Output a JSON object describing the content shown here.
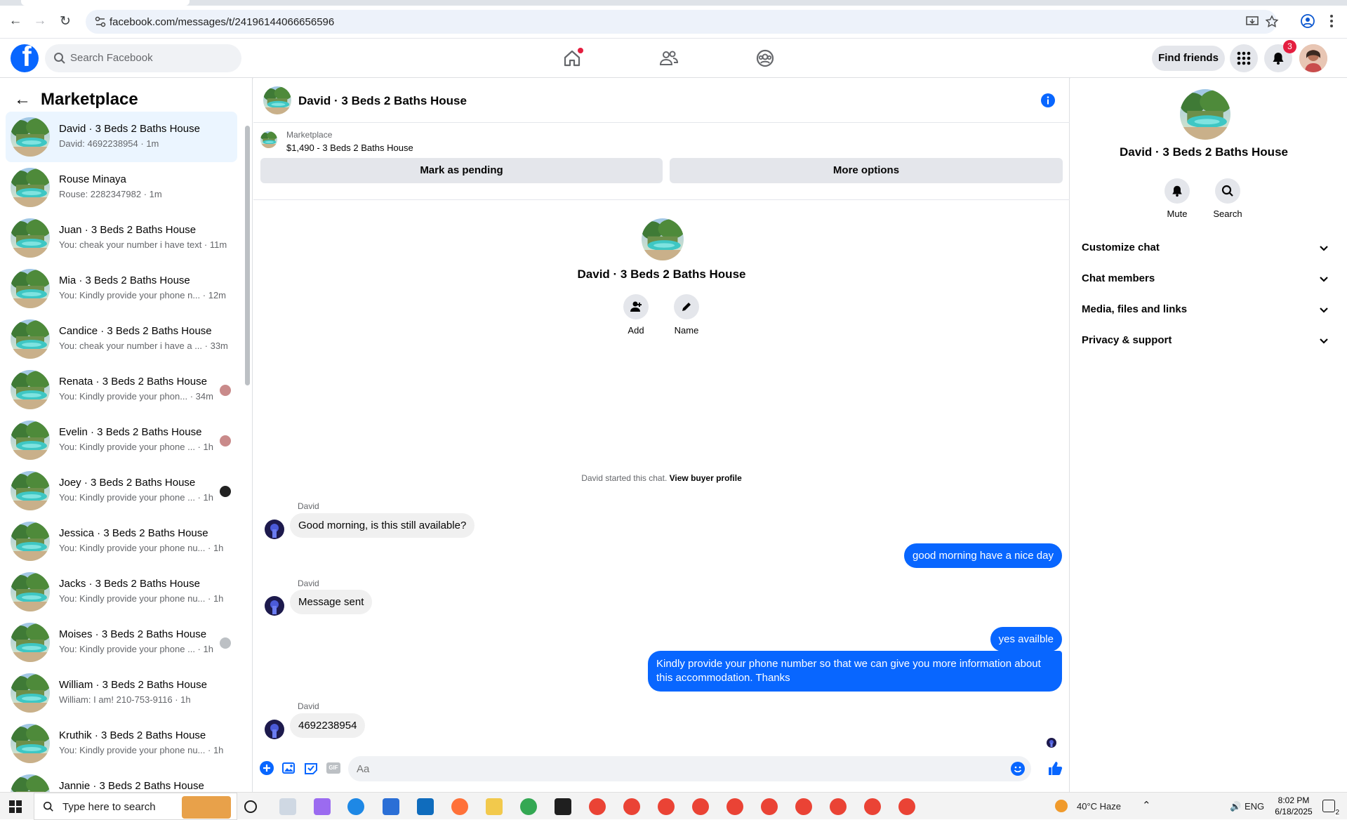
{
  "browser": {
    "url": "facebook.com/messages/t/24196144066656596"
  },
  "header": {
    "search_placeholder": "Search Facebook",
    "find_friends": "Find friends",
    "notification_count": "3",
    "logo_letter": "f"
  },
  "sidebar": {
    "title": "Marketplace",
    "conversations": [
      {
        "name": "David · 3 Beds 2 Baths House",
        "preview": "David: 4692238954 · 1m",
        "active": true
      },
      {
        "name": "Rouse Minaya",
        "preview": "Rouse: 2282347982 · 1m"
      },
      {
        "name": "Juan · 3 Beds 2 Baths House",
        "preview": "You: cheak your number i have text · 11m"
      },
      {
        "name": "Mia · 3 Beds 2 Baths House",
        "preview": "You: Kindly provide your phone n... · 12m"
      },
      {
        "name": "Candice · 3 Beds 2 Baths House",
        "preview": "You: cheak your number i have a ... · 33m"
      },
      {
        "name": "Renata · 3 Beds 2 Baths House",
        "preview": "You: Kindly provide your phon... · 34m"
      },
      {
        "name": "Evelin · 3 Beds 2 Baths House",
        "preview": "You: Kindly provide your phone ... · 1h"
      },
      {
        "name": "Joey · 3 Beds 2 Baths House",
        "preview": "You: Kindly provide your phone ... · 1h"
      },
      {
        "name": "Jessica · 3 Beds 2 Baths House",
        "preview": "You: Kindly provide your phone nu... · 1h"
      },
      {
        "name": "Jacks · 3 Beds 2 Baths House",
        "preview": "You: Kindly provide your phone nu... · 1h"
      },
      {
        "name": "Moises · 3 Beds 2 Baths House",
        "preview": "You: Kindly provide your phone ... · 1h"
      },
      {
        "name": "William · 3 Beds 2 Baths House",
        "preview": "William: I am! 210-753-9116 · 1h"
      },
      {
        "name": "Kruthik · 3 Beds 2 Baths House",
        "preview": "You: Kindly provide your phone nu... · 1h"
      },
      {
        "name": "Jannie · 3 Beds 2 Baths House",
        "preview": ""
      }
    ]
  },
  "chat": {
    "title": "David · 3 Beds 2 Baths House",
    "marketplace_label": "Marketplace",
    "listing": "$1,490 - 3 Beds 2 Baths House",
    "mark_pending": "Mark as pending",
    "more_options": "More options",
    "intro_name": "David · 3 Beds 2 Baths House",
    "add_label": "Add",
    "name_label": "Name",
    "started_text": "David started this chat.",
    "view_buyer_profile": "View buyer profile",
    "sender_name": "David",
    "messages": [
      {
        "from": "David",
        "text": "Good morning, is this still available?"
      },
      {
        "from": "me",
        "text": "good morning have a nice day"
      },
      {
        "from": "David",
        "text": "Message sent"
      },
      {
        "from": "me",
        "text": "yes availble"
      },
      {
        "from": "me",
        "text": "Kindly provide your phone number so that we can give you more information about this accommodation. Thanks"
      },
      {
        "from": "David",
        "text": "4692238954"
      }
    ],
    "composer_placeholder": "Aa",
    "gif_label": "GIF"
  },
  "info_panel": {
    "name": "David · 3 Beds 2 Baths House",
    "mute_label": "Mute",
    "search_label": "Search",
    "sections": [
      "Customize chat",
      "Chat members",
      "Media, files and links",
      "Privacy & support"
    ]
  },
  "taskbar": {
    "search_placeholder": "Type here to search",
    "weather": "40°C  Haze",
    "language": "ENG",
    "time": "8:02 PM",
    "date": "6/18/2025",
    "notif_count": "2"
  },
  "colors": {
    "brand": "#0866ff",
    "badge": "#e41e3f",
    "active_row": "#ebf5ff"
  }
}
